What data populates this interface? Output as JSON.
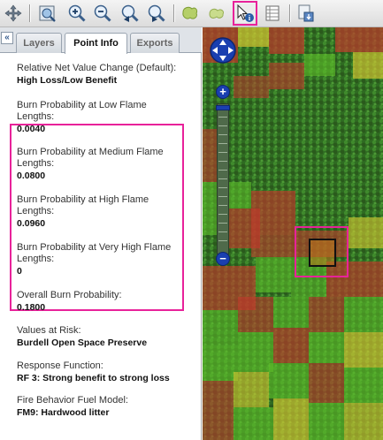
{
  "toolbar": {
    "tools": [
      {
        "name": "pan-icon"
      },
      {
        "name": "full-extent-icon"
      },
      {
        "name": "zoom-in-icon"
      },
      {
        "name": "zoom-out-icon"
      },
      {
        "name": "previous-extent-icon"
      },
      {
        "name": "next-extent-icon"
      },
      {
        "name": "select-polygon-icon"
      },
      {
        "name": "clear-selection-icon"
      },
      {
        "name": "identify-icon",
        "active": true
      },
      {
        "name": "table-icon"
      },
      {
        "name": "export-icon"
      }
    ],
    "highlight_color": "#e8229a"
  },
  "panel": {
    "collapse_label": "«",
    "tabs": [
      {
        "label": "Layers",
        "active": false
      },
      {
        "label": "Point Info",
        "active": true
      },
      {
        "label": "Exports",
        "active": false
      }
    ],
    "items": [
      {
        "label": "Relative Net Value Change (Default):",
        "value": "High Loss/Low Benefit"
      },
      {
        "label": "Burn Probability at Low Flame Lengths:",
        "value": "0.0040"
      },
      {
        "label": "Burn Probability at Medium Flame Lengths:",
        "value": "0.0800"
      },
      {
        "label": "Burn Probability at High Flame Lengths:",
        "value": "0.0960"
      },
      {
        "label": "Burn Probability at Very High Flame Lengths:",
        "value": "0"
      },
      {
        "label": "Overall Burn Probability:",
        "value": "0.1800"
      },
      {
        "label": "Values at Risk:",
        "value": "Burdell Open Space Preserve"
      },
      {
        "label": "Response Function:",
        "value": "RF 3: Strong benefit to strong loss"
      },
      {
        "label": "Fire Behavior Fuel Model:",
        "value": "FM9: Hardwood litter"
      }
    ]
  },
  "map": {
    "zoom_in_label": "+",
    "zoom_out_label": "−",
    "colors": {
      "high_loss": "#c0392b",
      "moderate": "#d8c832",
      "benefit": "#5fbf2a",
      "forest": "#2f6b22"
    }
  }
}
